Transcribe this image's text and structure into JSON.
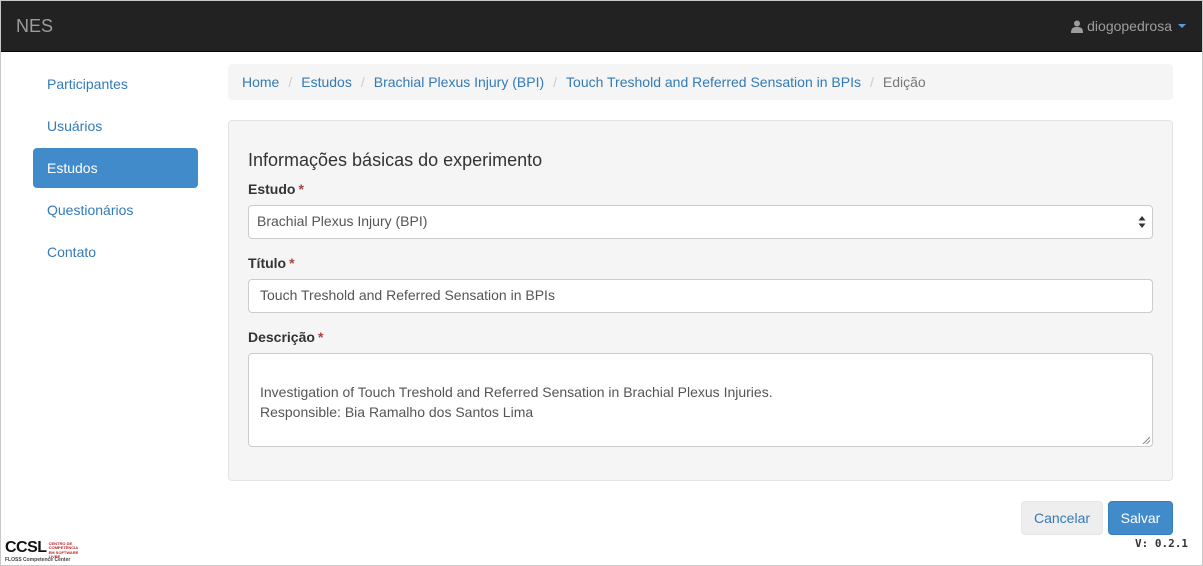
{
  "navbar": {
    "brand": "NES",
    "username": "diogopedrosa",
    "user_icon": "user-icon",
    "dropdown_icon": "caret-down-icon"
  },
  "sidebar": {
    "items": [
      {
        "label": "Participantes",
        "active": false
      },
      {
        "label": "Usuários",
        "active": false
      },
      {
        "label": "Estudos",
        "active": true
      },
      {
        "label": "Questionários",
        "active": false
      },
      {
        "label": "Contato",
        "active": false
      }
    ]
  },
  "breadcrumb": {
    "items": [
      {
        "label": "Home"
      },
      {
        "label": "Estudos"
      },
      {
        "label": "Brachial Plexus Injury (BPI)"
      },
      {
        "label": "Touch Treshold and Referred Sensation in BPIs"
      },
      {
        "label": "Edição"
      }
    ],
    "separator": "/"
  },
  "form": {
    "title": "Informações básicas do experimento",
    "required_marker": "*",
    "estudo": {
      "label": "Estudo",
      "value": "Brachial Plexus Injury (BPI)"
    },
    "titulo": {
      "label": "Título",
      "value": "Touch Treshold and Referred Sensation in BPIs"
    },
    "descricao": {
      "label": "Descrição",
      "value": "Investigation of Touch Treshold and Referred Sensation in Brachial Plexus Injuries.\nResponsible: Bia Ramalho dos Santos Lima"
    }
  },
  "actions": {
    "cancel_label": "Cancelar",
    "save_label": "Salvar"
  },
  "footer": {
    "version": "V: 0.2.1",
    "logo_text": "CCSL",
    "logo_sub": "Centro de Competência em Software Livre",
    "logo_foot": "FLOSS Competence Center"
  },
  "colors": {
    "navbar_bg": "#222222",
    "accent": "#428bca",
    "link": "#337ab7",
    "required": "#a94442"
  }
}
